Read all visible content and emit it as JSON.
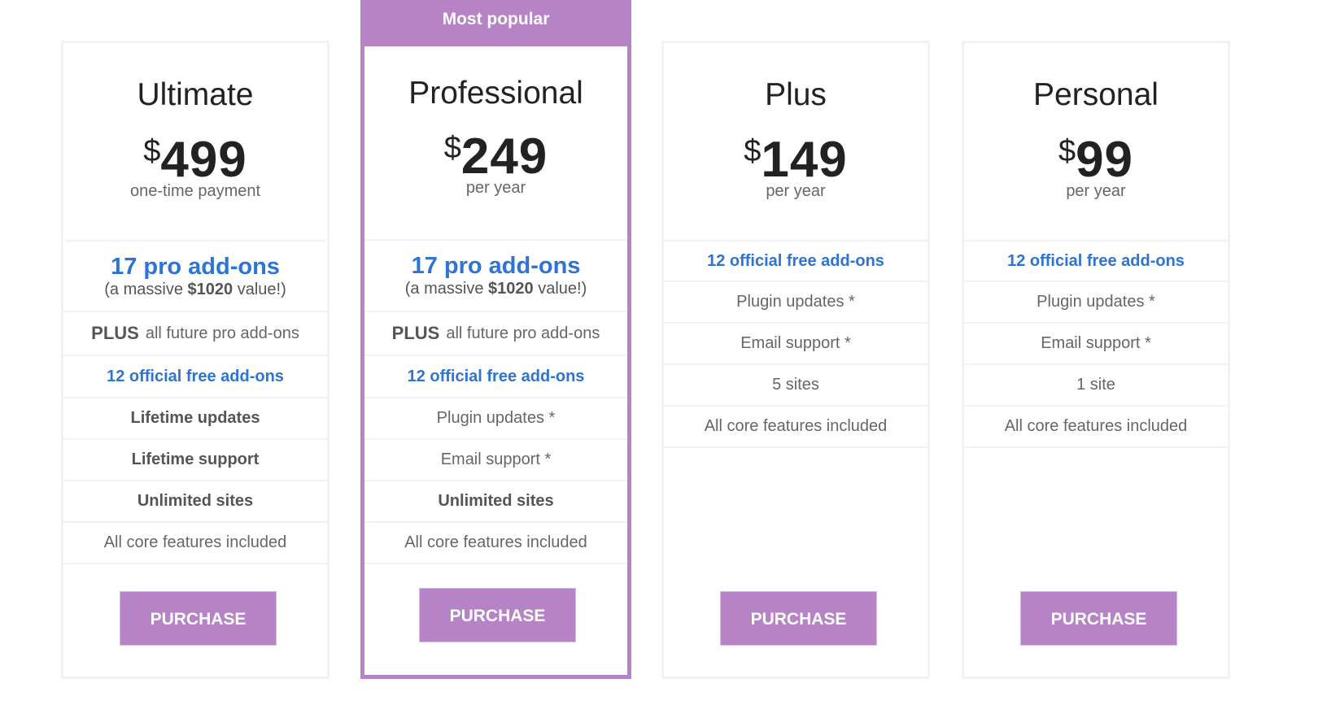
{
  "brand_color": "#b683c7",
  "link_color": "#2d74d4",
  "badge": "Most popular",
  "plans": [
    {
      "name": "Ultimate",
      "currency": "$",
      "price": "499",
      "period": "one-time payment",
      "features": [
        {
          "main": "17 pro add-ons",
          "sub_prefix": "(a massive ",
          "sub_value": "$1020",
          "sub_suffix": " value!)"
        },
        {
          "plus": "PLUS",
          "text": "all future pro add-ons"
        },
        {
          "text": "12 official free add-ons"
        },
        {
          "text": "Lifetime updates"
        },
        {
          "text": "Lifetime support"
        },
        {
          "text": "Unlimited sites"
        },
        {
          "text": "All core features included"
        }
      ],
      "button": "PURCHASE"
    },
    {
      "name": "Professional",
      "currency": "$",
      "price": "249",
      "period": "per year",
      "features": [
        {
          "main": "17 pro add-ons",
          "sub_prefix": "(a massive ",
          "sub_value": "$1020",
          "sub_suffix": " value!)"
        },
        {
          "plus": "PLUS",
          "text": "all future pro add-ons"
        },
        {
          "text": "12 official free add-ons"
        },
        {
          "text": "Plugin updates *"
        },
        {
          "text": "Email support *"
        },
        {
          "text": "Unlimited sites"
        },
        {
          "text": "All core features included"
        }
      ],
      "button": "PURCHASE"
    },
    {
      "name": "Plus",
      "currency": "$",
      "price": "149",
      "period": "per year",
      "features": [
        {
          "text": "12 official free add-ons"
        },
        {
          "text": "Plugin updates *"
        },
        {
          "text": "Email support *"
        },
        {
          "text": "5 sites"
        },
        {
          "text": "All core features included"
        }
      ],
      "button": "PURCHASE"
    },
    {
      "name": "Personal",
      "currency": "$",
      "price": "99",
      "period": "per year",
      "features": [
        {
          "text": "12 official free add-ons"
        },
        {
          "text": "Plugin updates *"
        },
        {
          "text": "Email support *"
        },
        {
          "text": "1 site"
        },
        {
          "text": "All core features included"
        }
      ],
      "button": "PURCHASE"
    }
  ]
}
